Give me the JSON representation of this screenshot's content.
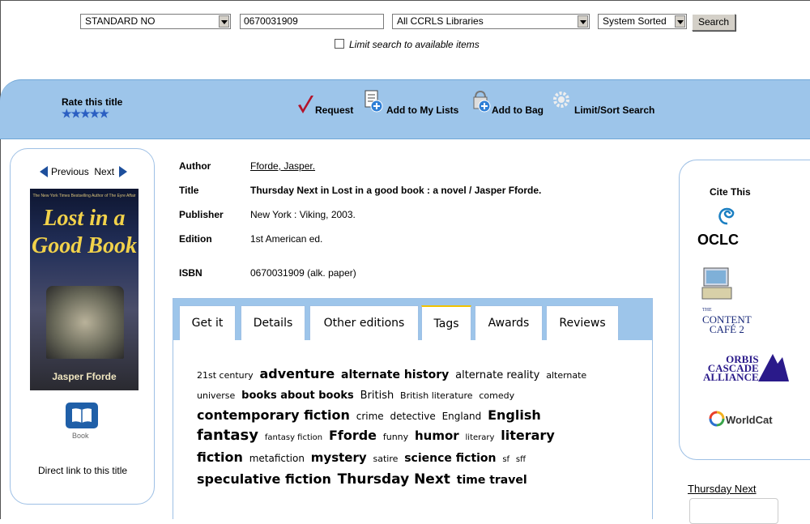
{
  "search": {
    "field": "STANDARD NO",
    "query": "0670031909",
    "library": "All CCRLS Libraries",
    "sort": "System Sorted",
    "button": "Search",
    "limit_label": "Limit search to available items"
  },
  "toolbar": {
    "rate_label": "Rate this title",
    "stars": "★★★★★",
    "request": "Request",
    "add_lists": "Add to My Lists",
    "add_bag": "Add to Bag",
    "limit_sort": "Limit/Sort Search"
  },
  "nav": {
    "previous": "Previous",
    "next": "Next"
  },
  "cover": {
    "tagline": "The New York Times Bestselling Author of The Eyre Affair",
    "title": "Lost in a Good Book",
    "author": "Jasper Fforde"
  },
  "format": {
    "label": "Book"
  },
  "direct_link": "Direct link to this title",
  "bib": {
    "author_label": "Author",
    "author": "Fforde, Jasper.",
    "title_label": "Title",
    "title": "Thursday Next in Lost in a good book : a novel / Jasper Fforde.",
    "publisher_label": "Publisher",
    "publisher": "New York : Viking, 2003.",
    "edition_label": "Edition",
    "edition": "1st American ed.",
    "isbn_label": "ISBN",
    "isbn": "0670031909 (alk. paper)"
  },
  "tabs": [
    "Get it",
    "Details",
    "Other editions",
    "Tags",
    "Awards",
    "Reviews"
  ],
  "active_tab": "Tags",
  "tags": [
    {
      "t": "21st century",
      "w": "normal",
      "s": 11
    },
    {
      "t": "adventure",
      "w": "bold",
      "s": 16
    },
    {
      "t": "alternate history",
      "w": "bold",
      "s": 14
    },
    {
      "t": "alternate reality",
      "w": "normal",
      "s": 13
    },
    {
      "t": "alternate universe",
      "w": "normal",
      "s": 11
    },
    {
      "t": "books about books",
      "w": "bold",
      "s": 13
    },
    {
      "t": "British",
      "w": "normal",
      "s": 13
    },
    {
      "t": "British literature",
      "w": "normal",
      "s": 11
    },
    {
      "t": "comedy",
      "w": "normal",
      "s": 11
    },
    {
      "t": "contemporary fiction",
      "w": "bold",
      "s": 16
    },
    {
      "t": "crime",
      "w": "normal",
      "s": 12
    },
    {
      "t": "detective",
      "w": "normal",
      "s": 12
    },
    {
      "t": "England",
      "w": "normal",
      "s": 12
    },
    {
      "t": "English",
      "w": "bold",
      "s": 16
    },
    {
      "t": "fantasy",
      "w": "bold",
      "s": 18
    },
    {
      "t": "fantasy fiction",
      "w": "normal",
      "s": 10
    },
    {
      "t": "Fforde",
      "w": "bold",
      "s": 16
    },
    {
      "t": "funny",
      "w": "normal",
      "s": 11
    },
    {
      "t": "humor",
      "w": "bold",
      "s": 15
    },
    {
      "t": "literary",
      "w": "normal",
      "s": 10
    },
    {
      "t": "literary fiction",
      "w": "bold",
      "s": 16
    },
    {
      "t": "metafiction",
      "w": "normal",
      "s": 12
    },
    {
      "t": "mystery",
      "w": "bold",
      "s": 15
    },
    {
      "t": "satire",
      "w": "normal",
      "s": 11
    },
    {
      "t": "science fiction",
      "w": "bold",
      "s": 14
    },
    {
      "t": "sf",
      "w": "normal",
      "s": 10
    },
    {
      "t": "sff",
      "w": "normal",
      "s": 10
    },
    {
      "t": "speculative fiction",
      "w": "bold",
      "s": 16
    },
    {
      "t": "Thursday Next",
      "w": "bold",
      "s": 17
    },
    {
      "t": "time travel",
      "w": "bold",
      "s": 14
    }
  ],
  "right": {
    "cite_this": "Cite This",
    "oclc": "OCLC",
    "content_cafe_1": "THE",
    "content_cafe_2": "CONTENT",
    "content_cafe_3": "CAFÉ 2",
    "orbis_1": "ORBIS",
    "orbis_2": "CASCADE",
    "orbis_3": "ALLIANCE",
    "worldcat": "WorldCat",
    "series_link": "Thursday Next"
  },
  "colors": {
    "toolbar_bg": "#9dc5ea",
    "nav_arrow": "#1d4f9c",
    "stars": "#2b5fc2",
    "active_tab_top": "#f2c200"
  }
}
